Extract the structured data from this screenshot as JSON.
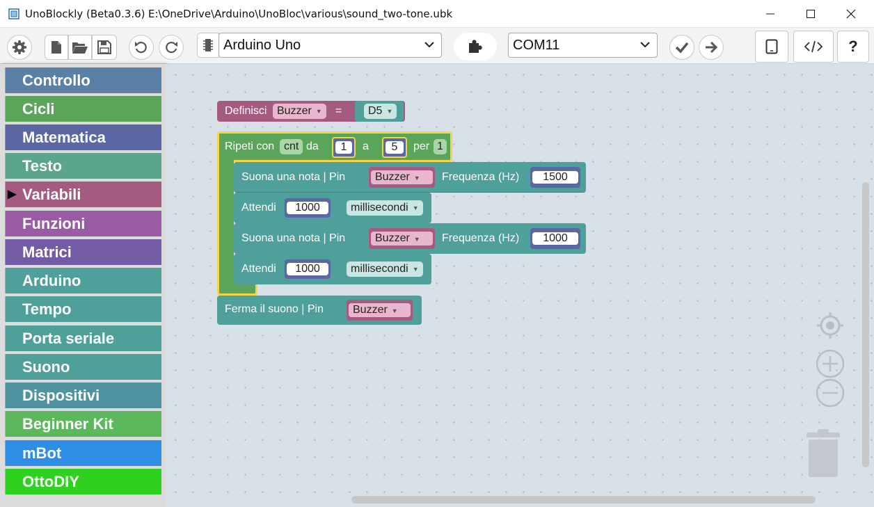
{
  "window": {
    "app_title": "UnoBlockly (Beta0.3.6)",
    "file_path": "E:\\OneDrive\\Arduino\\UnoBloc\\various\\sound_two-tone.ubk"
  },
  "toolbar": {
    "board_selected": "Arduino Uno",
    "port_selected": "COM11",
    "help_label": "?"
  },
  "sidebar": {
    "categories": [
      {
        "label": "Controllo",
        "color": "#5b80a5"
      },
      {
        "label": "Cicli",
        "color": "#5ba55b"
      },
      {
        "label": "Matematica",
        "color": "#5b67a5"
      },
      {
        "label": "Testo",
        "color": "#5ba58c"
      },
      {
        "label": "Variabili",
        "color": "#a55b80"
      },
      {
        "label": "Funzioni",
        "color": "#9a5ba5"
      },
      {
        "label": "Matrici",
        "color": "#745ba5"
      },
      {
        "label": "Arduino",
        "color": "#4fa09a"
      },
      {
        "label": "Tempo",
        "color": "#4fa09a"
      },
      {
        "label": "Porta seriale",
        "color": "#4fa09a"
      },
      {
        "label": "Suono",
        "color": "#4fa09a"
      },
      {
        "label": "Dispositivi",
        "color": "#4f93a0"
      },
      {
        "label": "Beginner Kit",
        "color": "#5cb85c"
      },
      {
        "label": "mBot",
        "color": "#2e8ee6"
      },
      {
        "label": "OttoDIY",
        "color": "#2ed11f"
      }
    ]
  },
  "blocks": {
    "define": {
      "label": "Definisci",
      "var": "Buzzer",
      "eq": "=",
      "pin": "D5"
    },
    "loop": {
      "label": "Ripeti con",
      "var": "cnt",
      "from_label": "da",
      "from": "1",
      "to_label": "a",
      "to": "5",
      "step_label": "per",
      "step": "1"
    },
    "tone1": {
      "label": "Suona una nota  |  Pin",
      "pin": "Buzzer",
      "freq_label": "Frequenza (Hz)",
      "freq": "1500"
    },
    "wait1": {
      "label": "Attendi",
      "value": "1000",
      "unit": "millisecondi"
    },
    "tone2": {
      "label": "Suona una nota  |  Pin",
      "pin": "Buzzer",
      "freq_label": "Frequenza (Hz)",
      "freq": "1000"
    },
    "wait2": {
      "label": "Attendi",
      "value": "1000",
      "unit": "millisecondi"
    },
    "notone": {
      "label": "Ferma il suono  |  Pin",
      "pin": "Buzzer"
    }
  },
  "colors": {
    "loop": "#5ba55b",
    "variables": "#a55b80",
    "arduino": "#4fa09a",
    "selection": "#f5d547"
  }
}
